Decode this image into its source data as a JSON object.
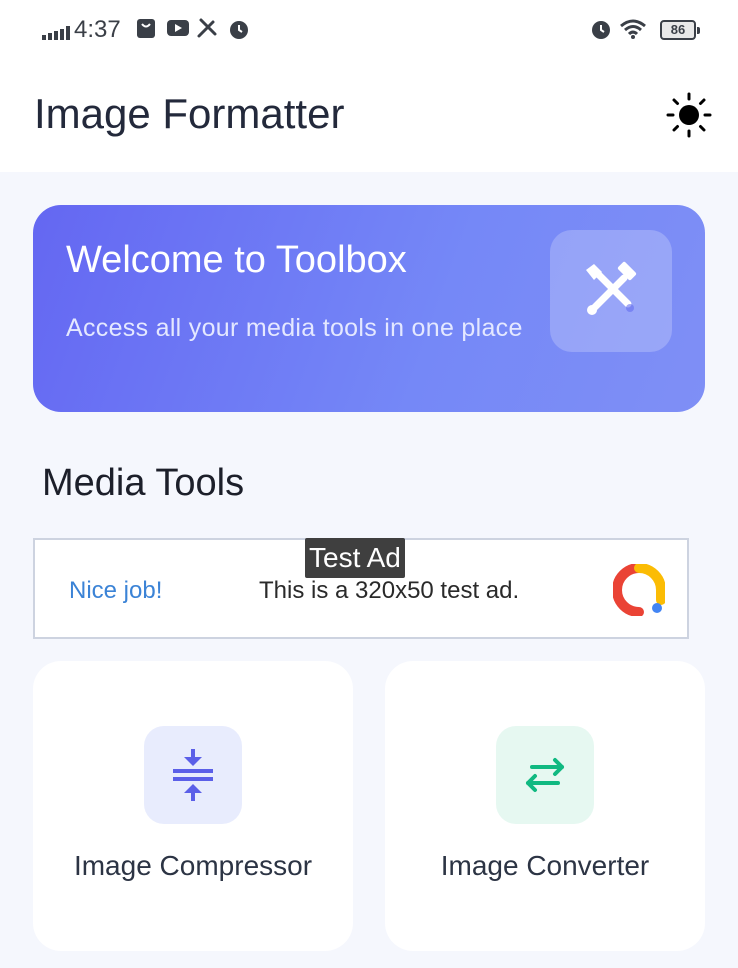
{
  "status_bar": {
    "time": "4:37",
    "battery": "86",
    "icons": [
      "signal-icon",
      "bag-icon",
      "youtube-icon",
      "tools-icon",
      "alarm-icon",
      "alarm-icon",
      "wifi-icon",
      "battery-icon"
    ]
  },
  "app_bar": {
    "title": "Image Formatter",
    "theme_icon": "sun-icon"
  },
  "banner": {
    "title": "Welcome to Toolbox",
    "subtitle": "Access all your media tools in one place",
    "icon": "tools-icon"
  },
  "section": {
    "title": "Media Tools"
  },
  "ad": {
    "badge": "Test Ad",
    "cta": "Nice job!",
    "text": "This is a 320x50 test ad."
  },
  "tools": [
    {
      "label": "Image Compressor",
      "icon": "compress-icon",
      "color": "#5b5fe8"
    },
    {
      "label": "Image Converter",
      "icon": "swap-arrows-icon",
      "color": "#10b981"
    }
  ],
  "colors": {
    "banner_start": "#6467f2",
    "banner_end": "#7f8ff6",
    "page_bg": "#f5f7fd"
  }
}
